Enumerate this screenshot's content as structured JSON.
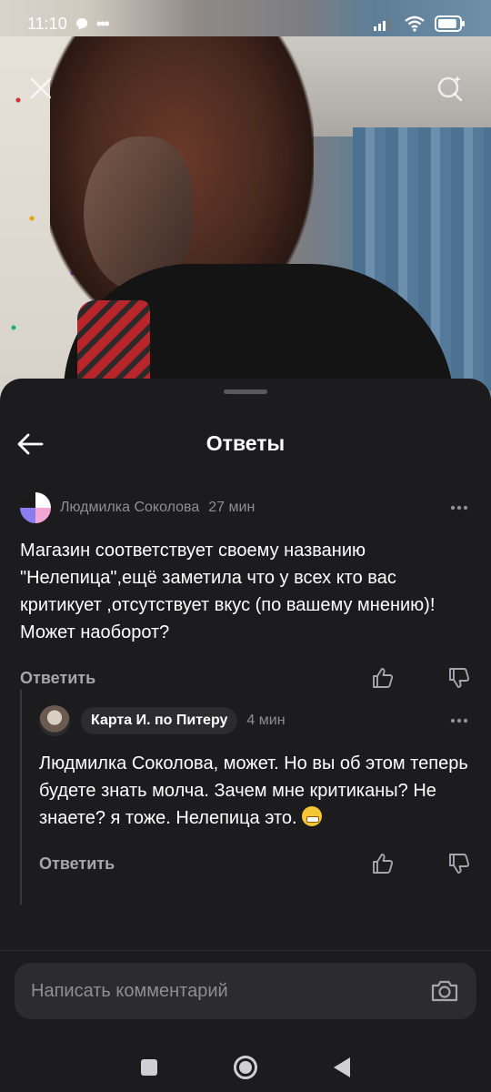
{
  "status_bar": {
    "time": "11:10",
    "dots": "•••",
    "battery_level": 0.9
  },
  "video": {
    "close_icon": "close-icon",
    "search_icon": "visual-search-icon"
  },
  "sheet": {
    "title": "Ответы",
    "back_icon": "arrow-left-icon"
  },
  "comment": {
    "author": "Людмилка Соколова",
    "time": "27 мин",
    "text": "Магазин соответствует своему названию \"Нелепица\",ещё заметила что у всех кто вас критикует ,отсутствует вкус (по вашему мнению)!Может наоборот?",
    "reply_label": "Ответить"
  },
  "reply": {
    "author": "Карта И. по Питеру",
    "time": "4 мин",
    "text": "Людмилка Соколова, может. Но вы об этом теперь будете знать молча. Зачем мне критиканы? Не знаете? я тоже. Нелепица это.",
    "emoji": "grinning-face",
    "reply_label": "Ответить"
  },
  "composer": {
    "placeholder": "Написать комментарий",
    "value": ""
  },
  "colors": {
    "sheet_bg": "#1c1c1e",
    "chip_bg": "#2c2c2e",
    "muted_text": "#8e8e93"
  }
}
